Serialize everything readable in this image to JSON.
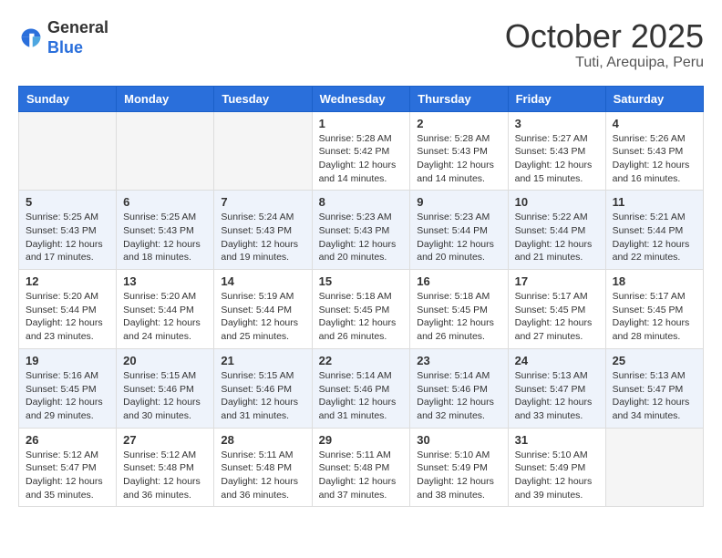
{
  "header": {
    "logo_general": "General",
    "logo_blue": "Blue",
    "month": "October 2025",
    "location": "Tuti, Arequipa, Peru"
  },
  "days_of_week": [
    "Sunday",
    "Monday",
    "Tuesday",
    "Wednesday",
    "Thursday",
    "Friday",
    "Saturday"
  ],
  "weeks": [
    {
      "days": [
        {
          "num": "",
          "info": ""
        },
        {
          "num": "",
          "info": ""
        },
        {
          "num": "",
          "info": ""
        },
        {
          "num": "1",
          "info": "Sunrise: 5:28 AM\nSunset: 5:42 PM\nDaylight: 12 hours\nand 14 minutes."
        },
        {
          "num": "2",
          "info": "Sunrise: 5:28 AM\nSunset: 5:43 PM\nDaylight: 12 hours\nand 14 minutes."
        },
        {
          "num": "3",
          "info": "Sunrise: 5:27 AM\nSunset: 5:43 PM\nDaylight: 12 hours\nand 15 minutes."
        },
        {
          "num": "4",
          "info": "Sunrise: 5:26 AM\nSunset: 5:43 PM\nDaylight: 12 hours\nand 16 minutes."
        }
      ]
    },
    {
      "days": [
        {
          "num": "5",
          "info": "Sunrise: 5:25 AM\nSunset: 5:43 PM\nDaylight: 12 hours\nand 17 minutes."
        },
        {
          "num": "6",
          "info": "Sunrise: 5:25 AM\nSunset: 5:43 PM\nDaylight: 12 hours\nand 18 minutes."
        },
        {
          "num": "7",
          "info": "Sunrise: 5:24 AM\nSunset: 5:43 PM\nDaylight: 12 hours\nand 19 minutes."
        },
        {
          "num": "8",
          "info": "Sunrise: 5:23 AM\nSunset: 5:43 PM\nDaylight: 12 hours\nand 20 minutes."
        },
        {
          "num": "9",
          "info": "Sunrise: 5:23 AM\nSunset: 5:44 PM\nDaylight: 12 hours\nand 20 minutes."
        },
        {
          "num": "10",
          "info": "Sunrise: 5:22 AM\nSunset: 5:44 PM\nDaylight: 12 hours\nand 21 minutes."
        },
        {
          "num": "11",
          "info": "Sunrise: 5:21 AM\nSunset: 5:44 PM\nDaylight: 12 hours\nand 22 minutes."
        }
      ]
    },
    {
      "days": [
        {
          "num": "12",
          "info": "Sunrise: 5:20 AM\nSunset: 5:44 PM\nDaylight: 12 hours\nand 23 minutes."
        },
        {
          "num": "13",
          "info": "Sunrise: 5:20 AM\nSunset: 5:44 PM\nDaylight: 12 hours\nand 24 minutes."
        },
        {
          "num": "14",
          "info": "Sunrise: 5:19 AM\nSunset: 5:44 PM\nDaylight: 12 hours\nand 25 minutes."
        },
        {
          "num": "15",
          "info": "Sunrise: 5:18 AM\nSunset: 5:45 PM\nDaylight: 12 hours\nand 26 minutes."
        },
        {
          "num": "16",
          "info": "Sunrise: 5:18 AM\nSunset: 5:45 PM\nDaylight: 12 hours\nand 26 minutes."
        },
        {
          "num": "17",
          "info": "Sunrise: 5:17 AM\nSunset: 5:45 PM\nDaylight: 12 hours\nand 27 minutes."
        },
        {
          "num": "18",
          "info": "Sunrise: 5:17 AM\nSunset: 5:45 PM\nDaylight: 12 hours\nand 28 minutes."
        }
      ]
    },
    {
      "days": [
        {
          "num": "19",
          "info": "Sunrise: 5:16 AM\nSunset: 5:45 PM\nDaylight: 12 hours\nand 29 minutes."
        },
        {
          "num": "20",
          "info": "Sunrise: 5:15 AM\nSunset: 5:46 PM\nDaylight: 12 hours\nand 30 minutes."
        },
        {
          "num": "21",
          "info": "Sunrise: 5:15 AM\nSunset: 5:46 PM\nDaylight: 12 hours\nand 31 minutes."
        },
        {
          "num": "22",
          "info": "Sunrise: 5:14 AM\nSunset: 5:46 PM\nDaylight: 12 hours\nand 31 minutes."
        },
        {
          "num": "23",
          "info": "Sunrise: 5:14 AM\nSunset: 5:46 PM\nDaylight: 12 hours\nand 32 minutes."
        },
        {
          "num": "24",
          "info": "Sunrise: 5:13 AM\nSunset: 5:47 PM\nDaylight: 12 hours\nand 33 minutes."
        },
        {
          "num": "25",
          "info": "Sunrise: 5:13 AM\nSunset: 5:47 PM\nDaylight: 12 hours\nand 34 minutes."
        }
      ]
    },
    {
      "days": [
        {
          "num": "26",
          "info": "Sunrise: 5:12 AM\nSunset: 5:47 PM\nDaylight: 12 hours\nand 35 minutes."
        },
        {
          "num": "27",
          "info": "Sunrise: 5:12 AM\nSunset: 5:48 PM\nDaylight: 12 hours\nand 36 minutes."
        },
        {
          "num": "28",
          "info": "Sunrise: 5:11 AM\nSunset: 5:48 PM\nDaylight: 12 hours\nand 36 minutes."
        },
        {
          "num": "29",
          "info": "Sunrise: 5:11 AM\nSunset: 5:48 PM\nDaylight: 12 hours\nand 37 minutes."
        },
        {
          "num": "30",
          "info": "Sunrise: 5:10 AM\nSunset: 5:49 PM\nDaylight: 12 hours\nand 38 minutes."
        },
        {
          "num": "31",
          "info": "Sunrise: 5:10 AM\nSunset: 5:49 PM\nDaylight: 12 hours\nand 39 minutes."
        },
        {
          "num": "",
          "info": ""
        }
      ]
    }
  ]
}
